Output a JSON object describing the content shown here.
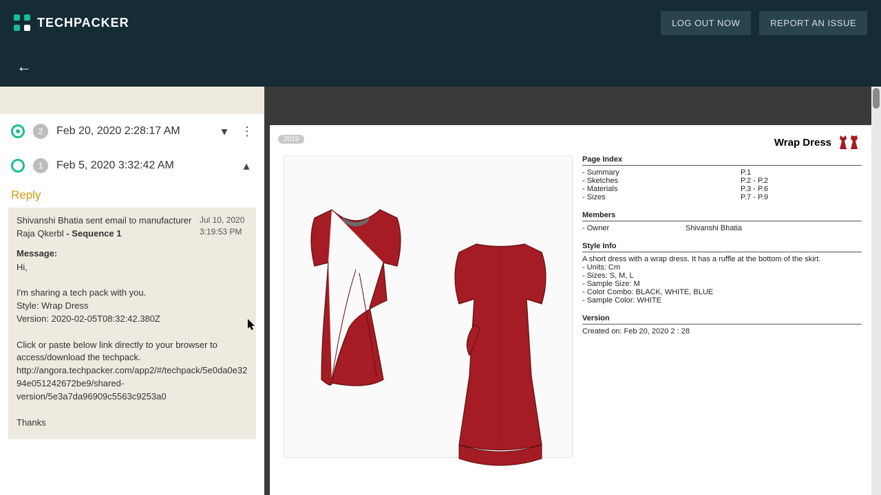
{
  "header": {
    "brand": "TECHPACKER",
    "logout": "LOG OUT NOW",
    "report": "REPORT AN ISSUE"
  },
  "sidebar": {
    "versions": [
      {
        "count": "2",
        "date": "Feb 20, 2020 2:28:17 AM",
        "expanded": false,
        "selected": true
      },
      {
        "count": "1",
        "date": "Feb 5, 2020 3:32:42 AM",
        "expanded": true,
        "selected": false
      }
    ],
    "reply_label": "Reply",
    "message": {
      "from_line": "Shivanshi Bhatia sent email to manufacturer Raja Qkerbl ",
      "sequence": "- Sequence 1",
      "timestamp": "Jul 10, 2020 3:19:53 PM",
      "label": "Message:",
      "body": "Hi,\n\nI'm sharing a tech pack with you.\nStyle: Wrap Dress\nVersion: 2020-02-05T08:32:42.380Z\n\nClick or paste below link directly to your browser to access/download the techpack.\nhttp://angora.techpacker.com/app2/#/techpack/5e0da0e3294e051242672be9/shared-version/5e3a7da96909c5563c9253a0\n\nThanks"
    }
  },
  "sheet": {
    "year_badge": "2019",
    "title": "Wrap Dress",
    "page_index": {
      "heading": "Page Index",
      "rows": [
        {
          "label": "- Summary",
          "pages": "P.1"
        },
        {
          "label": "- Sketches",
          "pages": "P.2 - P.2"
        },
        {
          "label": "- Materials",
          "pages": "P.3 - P.6"
        },
        {
          "label": "- Sizes",
          "pages": "P.7 - P.9"
        }
      ]
    },
    "members": {
      "heading": "Members",
      "rows": [
        {
          "role": "- Owner",
          "name": "Shivanshi Bhatia"
        }
      ]
    },
    "style_info": {
      "heading": "Style Info",
      "desc": "A short dress with a wrap dress. It has a ruffle at the bottom of the skirt.",
      "lines": [
        "- Units: Cm",
        "- Sizes: S, M, L",
        "- Sample Size: M",
        "- Color Combo: BLACK, WHITE, BLUE",
        "- Sample Color: WHITE"
      ]
    },
    "version_sec": {
      "heading": "Version",
      "line": "Created on: Feb 20, 2020 2 : 28"
    }
  }
}
